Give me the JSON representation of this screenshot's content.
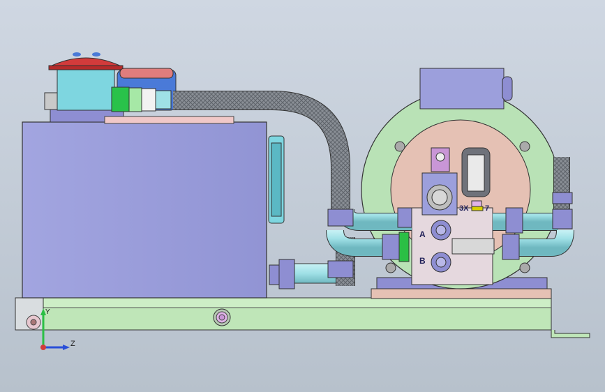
{
  "view": {
    "background_top": "#cfd7e2",
    "background_bottom": "#b7c1cc"
  },
  "colors": {
    "tank": "#9c9fdc",
    "base_rail": "#bfe6b8",
    "hose": "#8a8f96",
    "pipe": "#9fe0e6",
    "fitting": "#8e8ed2",
    "filler_cap": "#d23b3b",
    "filter": "#7ed6e0",
    "pump_flange": "#b9e2b6",
    "valve_block": "#e5d8de",
    "motor_box": "#9c9fdc"
  },
  "annotations": {
    "port_a": "A",
    "port_b": "B",
    "port_3x": "3X",
    "port_7": "7"
  },
  "triad": {
    "y_axis": "Y",
    "z_axis": "Z"
  },
  "icons": {
    "axis_triad": "triad-icon"
  }
}
